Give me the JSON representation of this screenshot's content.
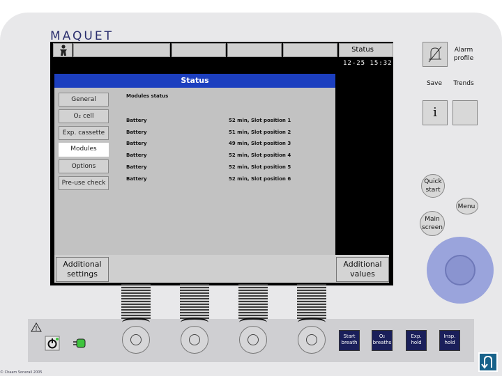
{
  "brand": "MAQUET",
  "header": {
    "status_label": "Status",
    "datetime": "12-25 15:32",
    "alarm_profile_label": "Alarm profile"
  },
  "status_window": {
    "title": "Status",
    "tabs": [
      {
        "label": "General",
        "active": false
      },
      {
        "label": "O₂ cell",
        "active": false
      },
      {
        "label": "Exp. cassette",
        "active": false
      },
      {
        "label": "Modules",
        "active": true
      },
      {
        "label": "Options",
        "active": false
      },
      {
        "label": "Pre-use check",
        "active": false
      }
    ],
    "section_title": "Modules status",
    "rows": [
      {
        "key": "Battery",
        "value": "52 min, Slot position 1"
      },
      {
        "key": "Battery",
        "value": "51 min, Slot position 2"
      },
      {
        "key": "Battery",
        "value": "49 min, Slot position 3"
      },
      {
        "key": "Battery",
        "value": "52 min, Slot position 4"
      },
      {
        "key": "Battery",
        "value": "52 min, Slot position 5"
      },
      {
        "key": "Battery",
        "value": "52 min, Slot position 6"
      }
    ]
  },
  "bottom": {
    "additional_settings": "Additional settings",
    "additional_values": "Additional values"
  },
  "side": {
    "save": "Save",
    "trends": "Trends",
    "info": "i",
    "quick_start": "Quick start",
    "menu": "Menu",
    "main_screen": "Main screen"
  },
  "hardware": {
    "start_breath": "Start breath",
    "o2_breaths": "O₂ breaths",
    "exp_hold": "Exp. hold",
    "insp_hold": "Insp. hold"
  },
  "footer": {
    "copyright": "© Chaam Sonerail 2005"
  },
  "icons": {
    "patient": "patient-icon",
    "bell": "alarm-bell-icon",
    "warning": "warning-triangle-icon",
    "power": "power-standby-icon",
    "plug": "mains-plug-icon",
    "nav": "u-turn-icon"
  },
  "colors": {
    "title_bar": "#1c3fbf",
    "knob": "#9aa4dc",
    "hw_button": "#1a1f5a",
    "nav_button": "#17628a"
  }
}
